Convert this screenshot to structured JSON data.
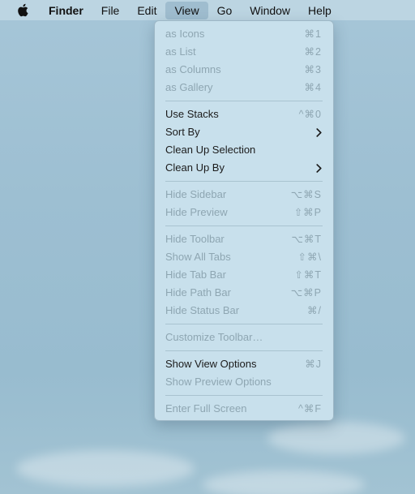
{
  "menubar": {
    "apple_icon": "apple-icon",
    "items": [
      {
        "label": "Finder"
      },
      {
        "label": "File"
      },
      {
        "label": "Edit"
      },
      {
        "label": "View"
      },
      {
        "label": "Go"
      },
      {
        "label": "Window"
      },
      {
        "label": "Help"
      }
    ]
  },
  "view_menu": {
    "groups": [
      [
        {
          "label": "as Icons",
          "shortcut": "⌘1"
        },
        {
          "label": "as List",
          "shortcut": "⌘2"
        },
        {
          "label": "as Columns",
          "shortcut": "⌘3"
        },
        {
          "label": "as Gallery",
          "shortcut": "⌘4"
        }
      ],
      [
        {
          "label": "Use Stacks",
          "shortcut": "^⌘0"
        },
        {
          "label": "Sort By",
          "submenu_icon": "chevron-right-icon"
        },
        {
          "label": "Clean Up Selection"
        },
        {
          "label": "Clean Up By",
          "submenu_icon": "chevron-right-icon"
        }
      ],
      [
        {
          "label": "Hide Sidebar",
          "shortcut": "⌥⌘S"
        },
        {
          "label": "Hide Preview",
          "shortcut": "⇧⌘P"
        }
      ],
      [
        {
          "label": "Hide Toolbar",
          "shortcut": "⌥⌘T"
        },
        {
          "label": "Show All Tabs",
          "shortcut": "⇧⌘\\"
        },
        {
          "label": "Hide Tab Bar",
          "shortcut": "⇧⌘T"
        },
        {
          "label": "Hide Path Bar",
          "shortcut": "⌥⌘P"
        },
        {
          "label": "Hide Status Bar",
          "shortcut": "⌘/"
        }
      ],
      [
        {
          "label": "Customize Toolbar…"
        }
      ],
      [
        {
          "label": "Show View Options",
          "shortcut": "⌘J"
        },
        {
          "label": "Show Preview Options"
        }
      ],
      [
        {
          "label": "Enter Full Screen",
          "shortcut": "^⌘F"
        }
      ]
    ]
  }
}
